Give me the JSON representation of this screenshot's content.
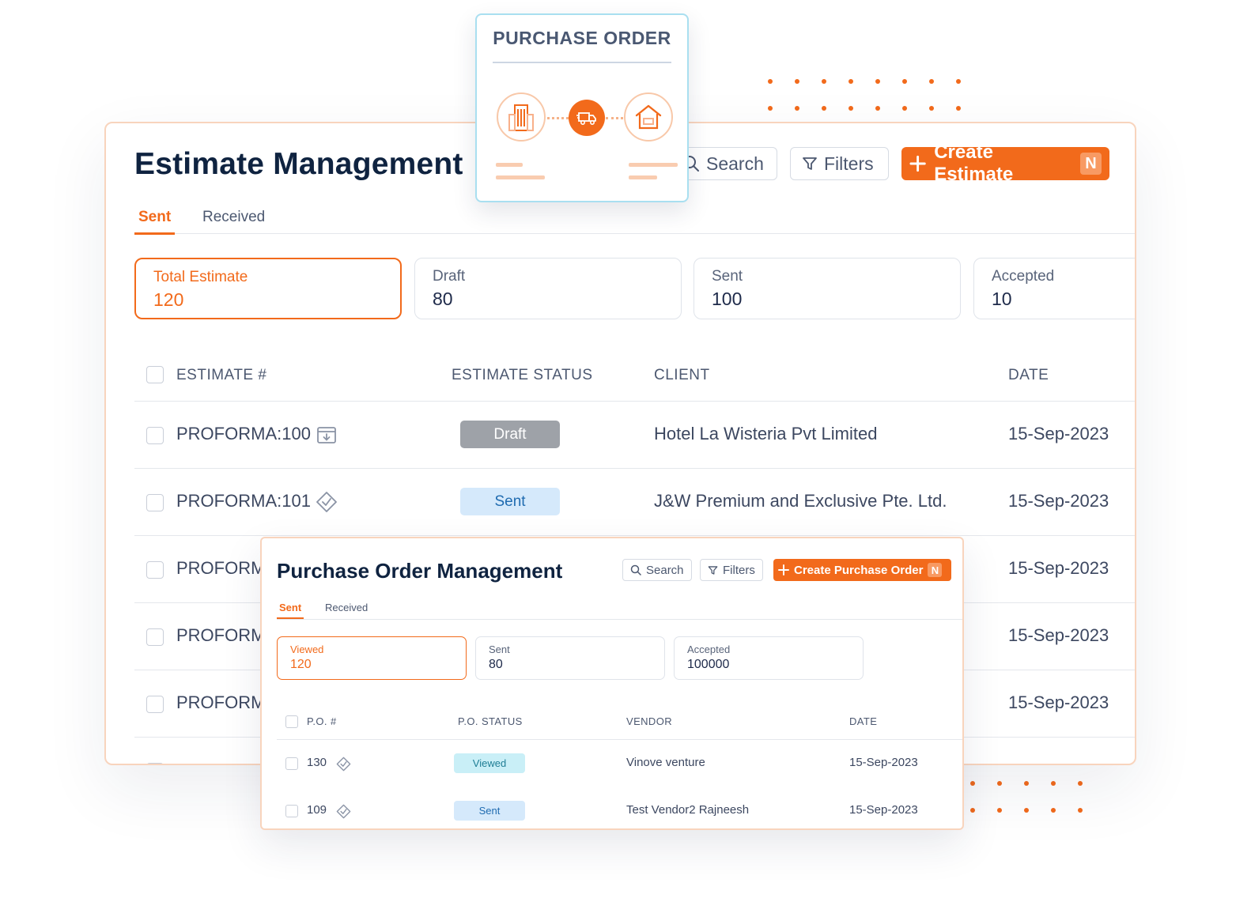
{
  "estimate": {
    "title": "Estimate Management",
    "search_label": "Search",
    "filters_label": "Filters",
    "create_label": "Create Estimate",
    "create_badge": "N",
    "tabs": [
      "Sent",
      "Received"
    ],
    "stats": [
      {
        "label": "Total Estimate",
        "value": "120"
      },
      {
        "label": "Draft",
        "value": "80"
      },
      {
        "label": "Sent",
        "value": "100"
      },
      {
        "label": "Accepted",
        "value": "10"
      }
    ],
    "columns": [
      "ESTIMATE #",
      "ESTIMATE STATUS",
      "CLIENT",
      "DATE"
    ],
    "rows": [
      {
        "id": "PROFORMA:100",
        "status": "Draft",
        "client": "Hotel La Wisteria Pvt Limited",
        "date": "15-Sep-2023"
      },
      {
        "id": "PROFORMA:101",
        "status": "Sent",
        "client": "J&W Premium and Exclusive Pte. Ltd.",
        "date": "15-Sep-2023"
      },
      {
        "id": "PROFORM",
        "date": "15-Sep-2023"
      },
      {
        "id": "PROFORM",
        "date": "15-Sep-2023"
      },
      {
        "id": "PROFORM",
        "date": "15-Sep-2023"
      }
    ]
  },
  "po_card": {
    "title": "PURCHASE ORDER"
  },
  "po": {
    "title": "Purchase Order Management",
    "search_label": "Search",
    "filters_label": "Filters",
    "create_label": "Create Purchase Order",
    "create_badge": "N",
    "tabs": [
      "Sent",
      "Received"
    ],
    "stats": [
      {
        "label": "Viewed",
        "value": "120"
      },
      {
        "label": "Sent",
        "value": "80"
      },
      {
        "label": "Accepted",
        "value": "100000"
      }
    ],
    "columns": [
      "P.O. #",
      "P.O. STATUS",
      "VENDOR",
      "DATE"
    ],
    "rows": [
      {
        "id": "130",
        "status": "Viewed",
        "vendor": "Vinove venture",
        "date": "15-Sep-2023"
      },
      {
        "id": "109",
        "status": "Sent",
        "vendor": "Test Vendor2 Rajneesh",
        "date": "15-Sep-2023"
      }
    ]
  },
  "colors": {
    "accent": "#f26a1b",
    "navy": "#0f2340",
    "sent_pill": "#d5e9fb",
    "viewed_pill": "#c9eff7",
    "draft_pill": "#9ea2a8"
  }
}
